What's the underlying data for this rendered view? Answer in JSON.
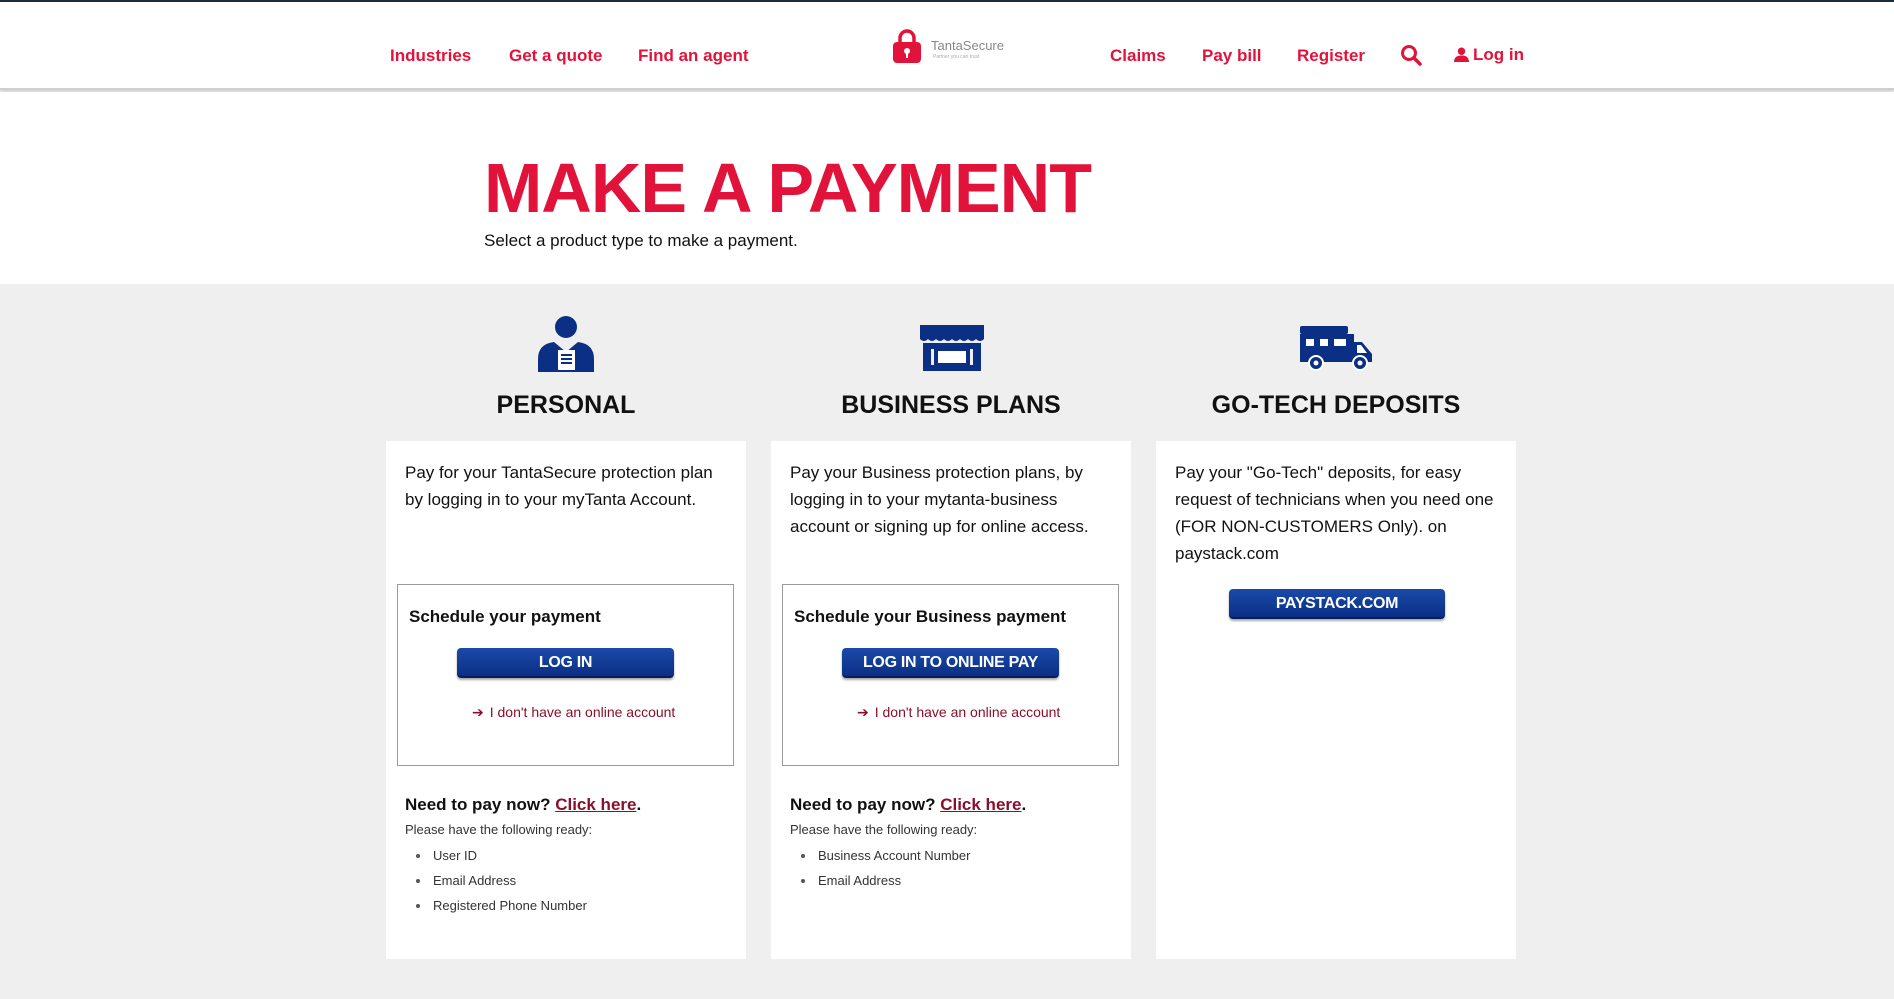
{
  "header": {
    "nav_left": [
      "Industries",
      "Get a quote",
      "Find an agent"
    ],
    "nav_right": [
      "Claims",
      "Pay bill",
      "Register"
    ],
    "logo_name": "TantaSecure",
    "logo_tagline": "Partner you can trust",
    "login_label": "Log in",
    "search_icon": "search-icon",
    "user_icon": "user-icon",
    "accent_color": "#e2133a"
  },
  "hero": {
    "title": "MAKE A PAYMENT",
    "subtitle": "Select a product type to make a payment."
  },
  "columns": [
    {
      "icon": "person-document-icon",
      "heading": "PERSONAL",
      "description": "Pay for your TantaSecure protection plan by logging in to your myTanta Account.",
      "schedule_title": "Schedule your payment",
      "button_label": "LOG IN",
      "no_account_label": "I don't have an online account",
      "pay_now_label": "Need to pay now?",
      "click_here_label": "Click here",
      "period": ".",
      "ready_note": "Please have the following ready:",
      "ready_items": [
        "User ID",
        "Email Address",
        "Registered Phone Number"
      ]
    },
    {
      "icon": "storefront-icon",
      "heading": "BUSINESS PLANS",
      "description": "Pay your Business protection plans, by logging in to your mytanta-business account or signing up for online access.",
      "schedule_title": "Schedule your Business payment",
      "button_label": "LOG IN TO ONLINE PAY",
      "no_account_label": "I don't have an online account",
      "pay_now_label": "Need to pay now?",
      "click_here_label": "Click here",
      "period": ".",
      "ready_note": "Please have the following ready:",
      "ready_items": [
        "Business Account Number",
        "Email Address"
      ]
    },
    {
      "icon": "rv-vehicle-icon",
      "heading": "GO-TECH DEPOSITS",
      "description": "Pay your \"Go-Tech\" deposits, for easy request of technicians when you need one (FOR NON-CUSTOMERS Only). on paystack.com",
      "button_label": "PAYSTACK.COM"
    }
  ],
  "colors": {
    "button_blue": "#0b2f85",
    "link_dark_red": "#8b0f2c",
    "icon_navy": "#0b2f85"
  }
}
